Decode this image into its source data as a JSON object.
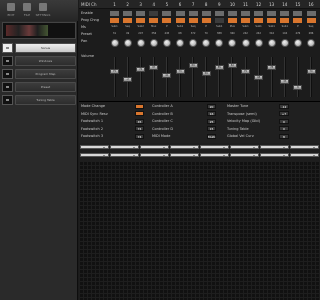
{
  "toolbar": {
    "buttons": [
      {
        "label": "EDIT",
        "icon": "pencil-icon"
      },
      {
        "label": "FILE",
        "icon": "folder-icon"
      },
      {
        "label": "SETTINGS",
        "icon": "gear-icon"
      }
    ]
  },
  "sidebar": {
    "items": [
      {
        "label": "Sonus",
        "active": true
      },
      {
        "label": "Windows",
        "active": false
      },
      {
        "label": "Program Map",
        "active": false
      },
      {
        "label": "Preset",
        "active": false
      },
      {
        "label": "Tuning Table",
        "active": false
      }
    ]
  },
  "grid": {
    "header_label": "MIDI Ch",
    "channels": [
      "1",
      "2",
      "3",
      "4",
      "5",
      "6",
      "7",
      "8",
      "9",
      "10",
      "11",
      "12",
      "13",
      "14",
      "15",
      "16"
    ],
    "row_labels": [
      "Enable",
      "Prog Chng",
      "Ms",
      "Preset",
      "Pan",
      "Volume"
    ],
    "ms_values": [
      "Sub1",
      "Seq",
      "Sub2",
      "Mux",
      "P",
      "Sub1",
      "Seq",
      "P",
      "Sub1",
      "Mux",
      "Sub1",
      "Sub1",
      "Sub1",
      "Sub1",
      "P",
      "Seq"
    ],
    "preset_values": [
      "31",
      "49",
      "207",
      "356",
      "445",
      "68",
      "372",
      "70",
      "388",
      "360",
      "242",
      "242",
      "342",
      "104",
      "476",
      "286"
    ],
    "fader_values": [
      "75",
      "-2",
      "74",
      "87",
      "41",
      "73",
      "89",
      "59",
      "85",
      "82",
      "75",
      "48",
      "78",
      "33",
      "8",
      "70"
    ]
  },
  "params": {
    "col1": [
      {
        "label": "Mode Change",
        "value": ""
      },
      {
        "label": "MIDI Sync Resv",
        "value": ""
      },
      {
        "label": "Footswitch 1",
        "value": "45"
      },
      {
        "label": "Footswitch 2",
        "value": "74"
      },
      {
        "label": "Footswitch 3",
        "value": "74"
      }
    ],
    "col2": [
      {
        "label": "Controller A",
        "value": "20"
      },
      {
        "label": "Controller B",
        "value": "16"
      },
      {
        "label": "Controller C",
        "value": "25"
      },
      {
        "label": "Controller D",
        "value": "15"
      },
      {
        "label": "MIDI Mode",
        "value": "Multi"
      }
    ],
    "col3": [
      {
        "label": "Master Tune",
        "value": "-12"
      },
      {
        "label": "Transpose (semi)",
        "value": "+7"
      },
      {
        "label": "Velocity Map (Glbl)",
        "value": "0"
      },
      {
        "label": "Tuning Table",
        "value": "0"
      },
      {
        "label": "Global Vel Curv",
        "value": "8"
      }
    ]
  },
  "colors": {
    "accent": "#d9762e",
    "cell_off": "#6c6c6c",
    "background": "#1c1c1c"
  }
}
